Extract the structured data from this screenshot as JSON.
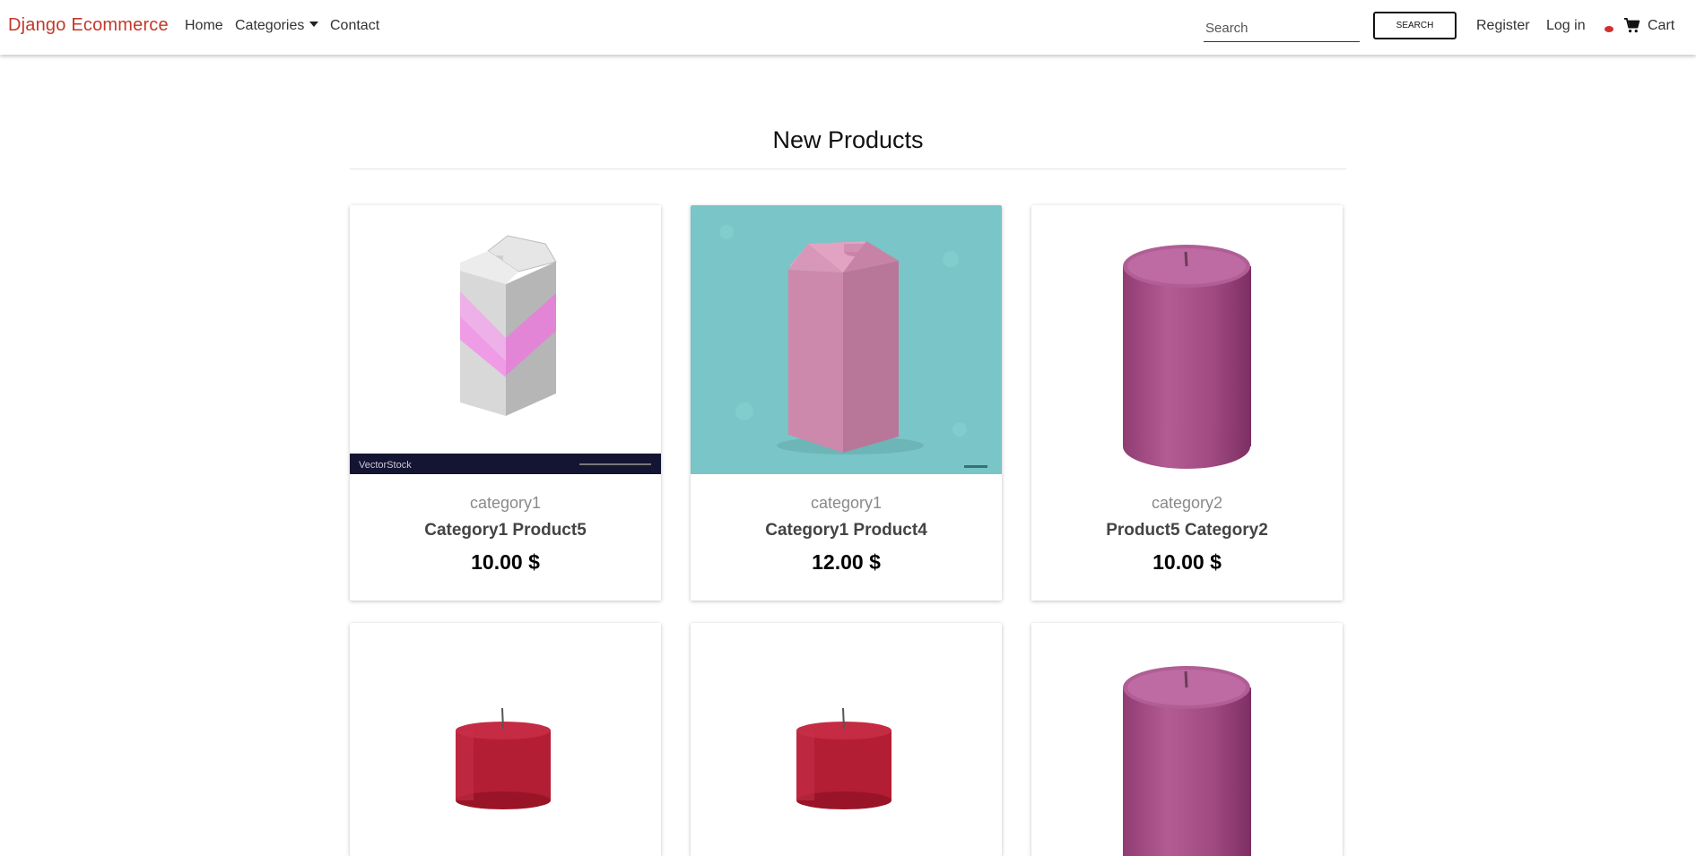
{
  "navbar": {
    "brand": "Django Ecommerce",
    "links": {
      "home": "Home",
      "categories": "Categories",
      "contact": "Contact"
    },
    "search": {
      "placeholder": "Search",
      "button_label": "SEARCH"
    },
    "register": "Register",
    "login": "Log in",
    "cart_label": "Cart",
    "accent_color": "#c0392b"
  },
  "main": {
    "title": "New Products",
    "products": [
      {
        "category": "category1",
        "name": "Category1 Product5",
        "price": "10.00 $",
        "image": "milk-carton-white-pink",
        "watermark": "VectorStock"
      },
      {
        "category": "category1",
        "name": "Category1 Product4",
        "price": "12.00 $",
        "image": "milk-carton-pink-teal"
      },
      {
        "category": "category2",
        "name": "Product5 Category2",
        "price": "10.00 $",
        "image": "candle-purple"
      },
      {
        "image": "candle-red"
      },
      {
        "image": "candle-red"
      },
      {
        "image": "candle-purple"
      }
    ]
  }
}
